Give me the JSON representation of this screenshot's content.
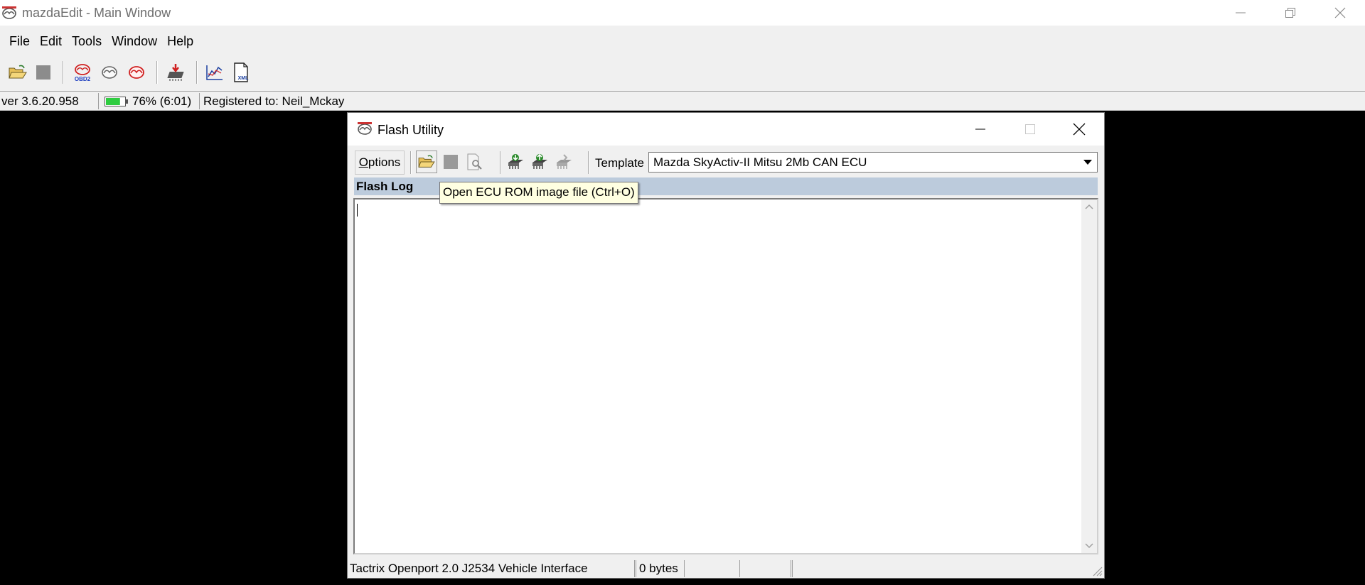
{
  "main_window": {
    "title": "mazdaEdit - Main Window",
    "menu": [
      "File",
      "Edit",
      "Tools",
      "Window",
      "Help"
    ],
    "status": {
      "version": "ver 3.6.20.958",
      "battery": "76% (6:01)",
      "battery_level": 0.76,
      "registered": "Registered to: Neil_Mckay"
    },
    "icons": {
      "obd_label": "OBD2",
      "xml_label": "XML"
    }
  },
  "flash_window": {
    "title": "Flash Utility",
    "options_mnemonic": "O",
    "options_rest": "ptions",
    "template_label": "Template",
    "template_value": "Mazda SkyActiv-II Mitsu 2Mb CAN ECU",
    "log_label": "Flash Log",
    "status": {
      "interface": "Tactrix Openport 2.0 J2534 Vehicle Interface",
      "size": "0 bytes"
    }
  },
  "tooltip": "Open ECU ROM image file (Ctrl+O)",
  "colors": {
    "log_header": "#bccbdc",
    "battery_green": "#2ecc40",
    "tooltip_bg": "#ffffe1",
    "accent_red": "#d02020"
  }
}
